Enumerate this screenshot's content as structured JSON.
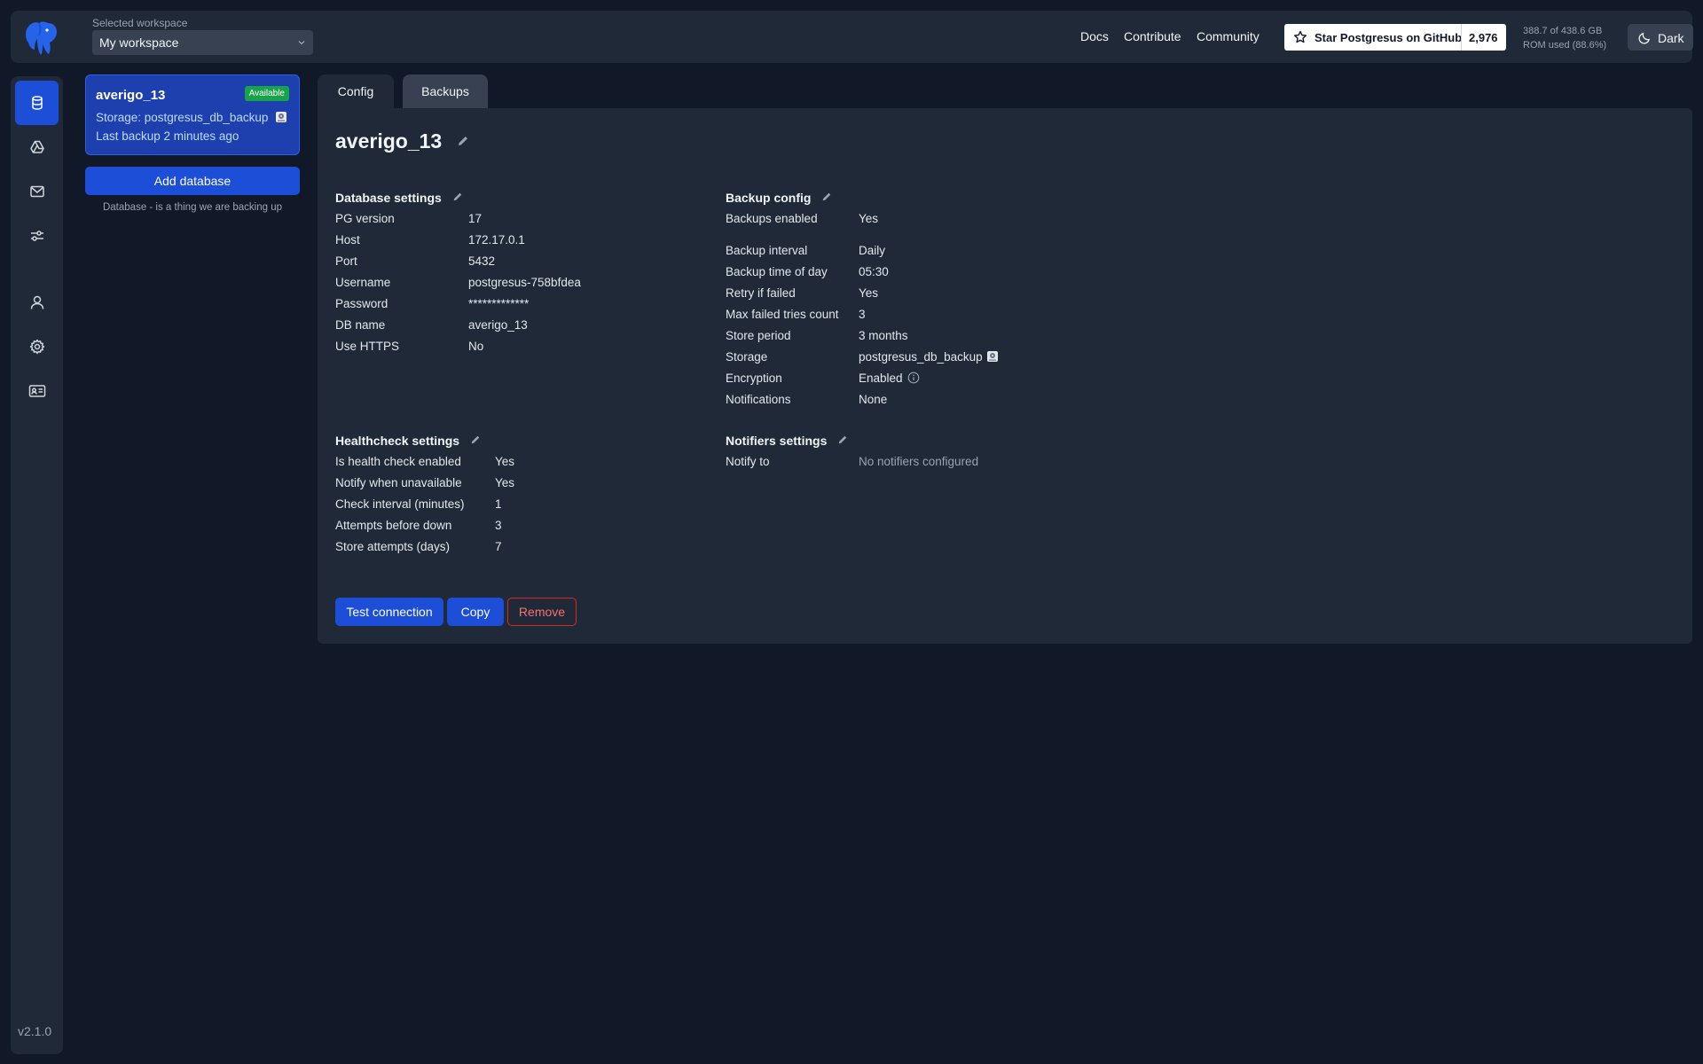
{
  "header": {
    "workspace_label": "Selected workspace",
    "workspace_value": "My workspace",
    "nav": [
      "Docs",
      "Contribute",
      "Community"
    ],
    "star_label": "Star Postgresus on GitHub",
    "star_count": "2,976",
    "rom_line1": "388.7 of 438.6 GB",
    "rom_line2": "ROM used (88.6%)",
    "theme_label": "Dark"
  },
  "rail": {
    "items": [
      "databases-icon",
      "storages-icon",
      "notifiers-icon",
      "settings-sliders-icon",
      "user-icon",
      "gear-icon",
      "id-card-icon"
    ],
    "version": "v2.1.0"
  },
  "database_list": {
    "selected": {
      "name": "averigo_13",
      "status": "Available",
      "storage": "Storage: postgresus_db_backup",
      "last_backup": "Last backup 2 minutes ago"
    },
    "add_label": "Add database",
    "hint": "Database - is a thing we are backing up"
  },
  "tabs": [
    "Config",
    "Backups"
  ],
  "detail": {
    "title": "averigo_13",
    "database_settings": {
      "heading": "Database settings",
      "rows": [
        {
          "k": "PG version",
          "v": "17"
        },
        {
          "k": "Host",
          "v": "172.17.0.1"
        },
        {
          "k": "Port",
          "v": "5432"
        },
        {
          "k": "Username",
          "v": "postgresus-758bfdea"
        },
        {
          "k": "Password",
          "v": "*************"
        },
        {
          "k": "DB name",
          "v": "averigo_13"
        },
        {
          "k": "Use HTTPS",
          "v": "No"
        }
      ]
    },
    "backup_config": {
      "heading": "Backup config",
      "rows": [
        {
          "k": "Backups enabled",
          "v": "Yes"
        },
        {
          "k": "Backup interval",
          "v": "Daily"
        },
        {
          "k": "Backup time of day",
          "v": "05:30"
        },
        {
          "k": "Retry if failed",
          "v": "Yes"
        },
        {
          "k": "Max failed tries count",
          "v": "3"
        },
        {
          "k": "Store period",
          "v": "3 months"
        },
        {
          "k": "Storage",
          "v": "postgresus_db_backup"
        },
        {
          "k": "Encryption",
          "v": "Enabled"
        },
        {
          "k": "Notifications",
          "v": "None"
        }
      ]
    },
    "healthcheck_settings": {
      "heading": "Healthcheck settings",
      "rows": [
        {
          "k": "Is health check enabled",
          "v": "Yes"
        },
        {
          "k": "Notify when unavailable",
          "v": "Yes"
        },
        {
          "k": "Check interval (minutes)",
          "v": "1"
        },
        {
          "k": "Attempts before down",
          "v": "3"
        },
        {
          "k": "Store attempts (days)",
          "v": "7"
        }
      ]
    },
    "notifiers_settings": {
      "heading": "Notifiers settings",
      "rows": [
        {
          "k": "Notify to",
          "v": "No notifiers configured"
        }
      ]
    },
    "actions": {
      "test": "Test connection",
      "copy": "Copy",
      "remove": "Remove"
    }
  },
  "colors": {
    "background": "#111827",
    "panel": "#1f2937",
    "accent": "#1d4ed8",
    "available": "#16a34a",
    "danger": "#dc2626"
  }
}
